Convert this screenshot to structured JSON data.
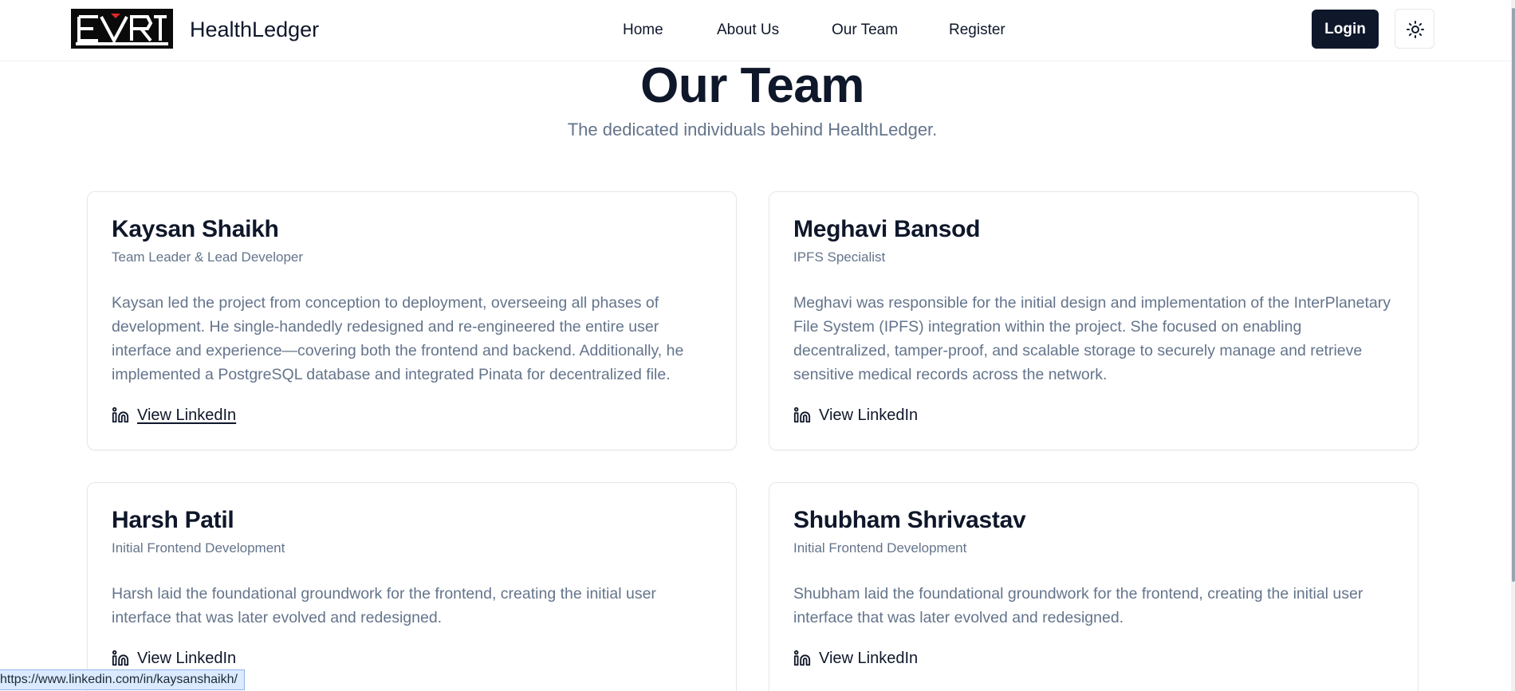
{
  "header": {
    "brand": "HealthLedger",
    "nav": [
      {
        "label": "Home"
      },
      {
        "label": "About Us"
      },
      {
        "label": "Our Team"
      },
      {
        "label": "Register"
      }
    ],
    "login_label": "Login",
    "theme_icon": "sun-icon",
    "logo_icon": "brand-logo-icon"
  },
  "page": {
    "title": "Our Team",
    "subtitle": "The dedicated individuals behind HealthLedger."
  },
  "team": [
    {
      "name": "Kaysan Shaikh",
      "role": "Team Leader & Lead Developer",
      "description": "Kaysan led the project from conception to deployment, overseeing all phases of development. He single-handedly redesigned and re-engineered the entire user interface and experience—covering both the frontend and backend. Additionally, he implemented a PostgreSQL database and integrated Pinata for decentralized file.",
      "link_label": "View LinkedIn"
    },
    {
      "name": "Meghavi Bansod",
      "role": "IPFS Specialist",
      "description": "Meghavi was responsible for the initial design and implementation of the InterPlanetary File System (IPFS) integration within the project. She focused on enabling decentralized, tamper-proof, and scalable storage to securely manage and retrieve sensitive medical records across the network.",
      "link_label": "View LinkedIn"
    },
    {
      "name": "Harsh Patil",
      "role": "Initial Frontend Development",
      "description": "Harsh laid the foundational groundwork for the frontend, creating the initial user interface that was later evolved and redesigned.",
      "link_label": "View LinkedIn"
    },
    {
      "name": "Shubham Shrivastav",
      "role": "Initial Frontend Development",
      "description": "Shubham laid the foundational groundwork for the frontend, creating the initial user interface that was later evolved and redesigned.",
      "link_label": "View LinkedIn"
    }
  ],
  "status_bar": {
    "url": "https://www.linkedin.com/in/kaysanshaikh/"
  },
  "colors": {
    "primary": "#0f172a",
    "muted_text": "#64748b",
    "border": "#e5e7eb",
    "status_bg": "#dbeafe"
  }
}
